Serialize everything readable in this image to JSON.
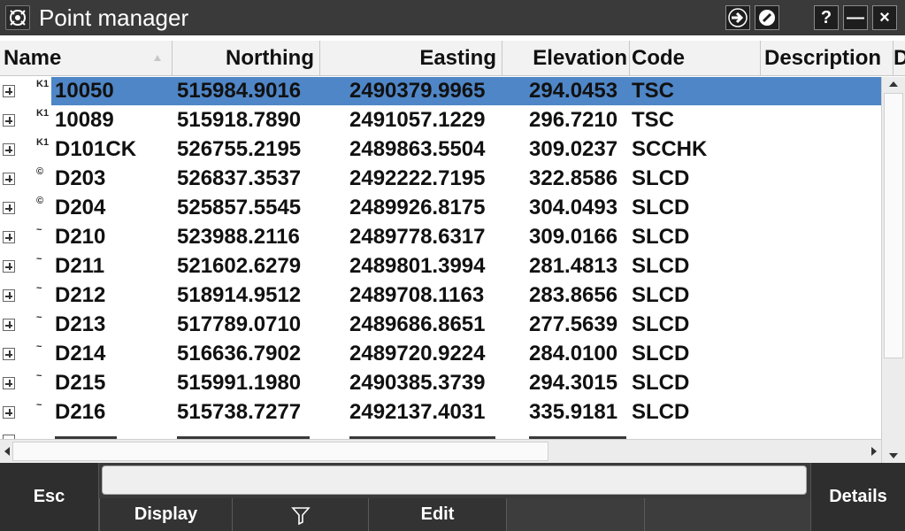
{
  "window": {
    "title": "Point manager",
    "icon": "trimble-app-icon",
    "buttons": {
      "login_icon": "login-arrow-icon",
      "settings_icon": "compass-icon",
      "help_label": "?",
      "minimize_label": "—",
      "close_label": "×"
    }
  },
  "table": {
    "columns": [
      {
        "label": "Name"
      },
      {
        "label": "Northing"
      },
      {
        "label": "Easting"
      },
      {
        "label": "Elevation"
      },
      {
        "label": "Code"
      },
      {
        "label": "Description"
      },
      {
        "label": "D"
      }
    ],
    "sort_column": "Name",
    "rows": [
      {
        "type": "K1",
        "name": "10050",
        "northing": "515984.9016",
        "easting": "2490379.9965",
        "elevation": "294.0453",
        "code": "TSC",
        "selected": true
      },
      {
        "type": "K1",
        "name": "10089",
        "northing": "515918.7890",
        "easting": "2491057.1229",
        "elevation": "296.7210",
        "code": "TSC"
      },
      {
        "type": "K1",
        "name": "D101CK",
        "northing": "526755.2195",
        "easting": "2489863.5504",
        "elevation": "309.0237",
        "code": "SCCHK"
      },
      {
        "type": "©",
        "name": "D203",
        "northing": "526837.3537",
        "easting": "2492222.7195",
        "elevation": "322.8586",
        "code": "SLCD"
      },
      {
        "type": "©",
        "name": "D204",
        "northing": "525857.5545",
        "easting": "2489926.8175",
        "elevation": "304.0493",
        "code": "SLCD"
      },
      {
        "type": "~",
        "name": "D210",
        "northing": "523988.2116",
        "easting": "2489778.6317",
        "elevation": "309.0166",
        "code": "SLCD"
      },
      {
        "type": "~",
        "name": "D211",
        "northing": "521602.6279",
        "easting": "2489801.3994",
        "elevation": "281.4813",
        "code": "SLCD"
      },
      {
        "type": "~",
        "name": "D212",
        "northing": "518914.9512",
        "easting": "2489708.1163",
        "elevation": "283.8656",
        "code": "SLCD"
      },
      {
        "type": "~",
        "name": "D213",
        "northing": "517789.0710",
        "easting": "2489686.8651",
        "elevation": "277.5639",
        "code": "SLCD"
      },
      {
        "type": "~",
        "name": "D214",
        "northing": "516636.7902",
        "easting": "2489720.9224",
        "elevation": "284.0100",
        "code": "SLCD"
      },
      {
        "type": "~",
        "name": "D215",
        "northing": "515991.1980",
        "easting": "2490385.3739",
        "elevation": "294.3015",
        "code": "SLCD"
      },
      {
        "type": "~",
        "name": "D216",
        "northing": "515738.7277",
        "easting": "2492137.4031",
        "elevation": "335.9181",
        "code": "SLCD"
      }
    ]
  },
  "bottom": {
    "esc_label": "Esc",
    "details_label": "Details",
    "input_value": "",
    "softkeys": [
      {
        "label": "Display"
      },
      {
        "label": "",
        "icon": "filter-icon"
      },
      {
        "label": "Edit"
      },
      {
        "label": ""
      },
      {
        "label": ""
      }
    ]
  },
  "colors": {
    "selection": "#4f86c7",
    "titlebar": "#3a3a3a",
    "bottombar": "#2e2e2e"
  }
}
